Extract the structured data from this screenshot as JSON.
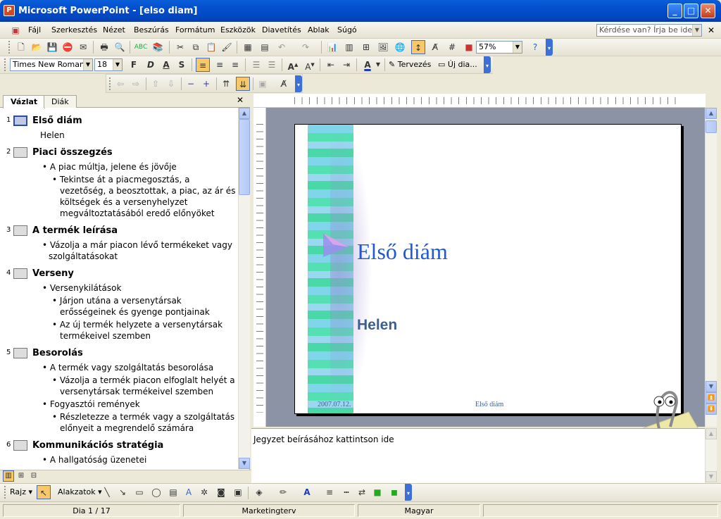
{
  "window": {
    "title": "Microsoft PowerPoint - [elso diam]"
  },
  "menu": {
    "items": [
      "Fájl",
      "Szerkesztés",
      "Nézet",
      "Beszúrás",
      "Formátum",
      "Eszközök",
      "Diavetítés",
      "Ablak",
      "Súgó"
    ],
    "help_box": "Kérdése van? Írja be ide."
  },
  "toolbar": {
    "zoom": "57%",
    "font": "Times New Roman",
    "font_size": "18",
    "bold": "F",
    "italic": "D",
    "underline": "A",
    "shadow": "S",
    "design_label": "Tervezés",
    "new_slide_label": "Új dia..."
  },
  "tabs": {
    "outline": "Vázlat",
    "slides": "Diák"
  },
  "outline": [
    {
      "num": "1",
      "title": "Első diám",
      "lines": [
        {
          "text": "Helen",
          "level": 0
        }
      ]
    },
    {
      "num": "2",
      "title": "Piaci összegzés",
      "lines": [
        {
          "text": "A piac múltja, jelene és jövője",
          "level": 1
        },
        {
          "text": "Tekintse át a piacmegosztás, a vezetőség, a beosztottak, a piac, az ár és költségek és a versenyhelyzet megváltoztatásából eredő előnyöket",
          "level": 2
        }
      ]
    },
    {
      "num": "3",
      "title": "A termék leírása",
      "lines": [
        {
          "text": "Vázolja a már piacon lévő termékeket vagy szolgáltatásokat",
          "level": 1
        }
      ]
    },
    {
      "num": "4",
      "title": "Verseny",
      "lines": [
        {
          "text": "Versenykilátások",
          "level": 1
        },
        {
          "text": "Járjon utána a versenytársak erősségeinek és gyenge pontjainak",
          "level": 2
        },
        {
          "text": "Az új termék helyzete a versenytársak termékeivel szemben",
          "level": 2
        }
      ]
    },
    {
      "num": "5",
      "title": "Besorolás",
      "lines": [
        {
          "text": "A termék vagy szolgáltatás besorolása",
          "level": 1
        },
        {
          "text": "Vázolja a termék piacon elfoglalt helyét a versenytársak termékeivel szemben",
          "level": 2
        },
        {
          "text": "Fogyasztói remények",
          "level": 1
        },
        {
          "text": "Részletezze a termék vagy a szolgáltatás előnyeit a megrendelő számára",
          "level": 2
        }
      ]
    },
    {
      "num": "6",
      "title": "Kommunikációs stratégia",
      "lines": [
        {
          "text": "A hallgatóság üzenetei",
          "level": 1
        }
      ]
    }
  ],
  "slide": {
    "title": "Első diám",
    "subtitle": "Helen",
    "footer_date": "2007.07.12.",
    "footer_title": "Első diám"
  },
  "notes": {
    "placeholder": "Jegyzet beírásához kattintson ide"
  },
  "drawing": {
    "draw": "Rajz",
    "autoshapes": "Alakzatok"
  },
  "status": {
    "slide": "Dia 1 / 17",
    "design": "Marketingterv",
    "language": "Magyar"
  },
  "colors": {
    "titlebar": "#0451d0",
    "slide_title": "#1e5ad8",
    "subtitle": "#3d5f8f"
  }
}
